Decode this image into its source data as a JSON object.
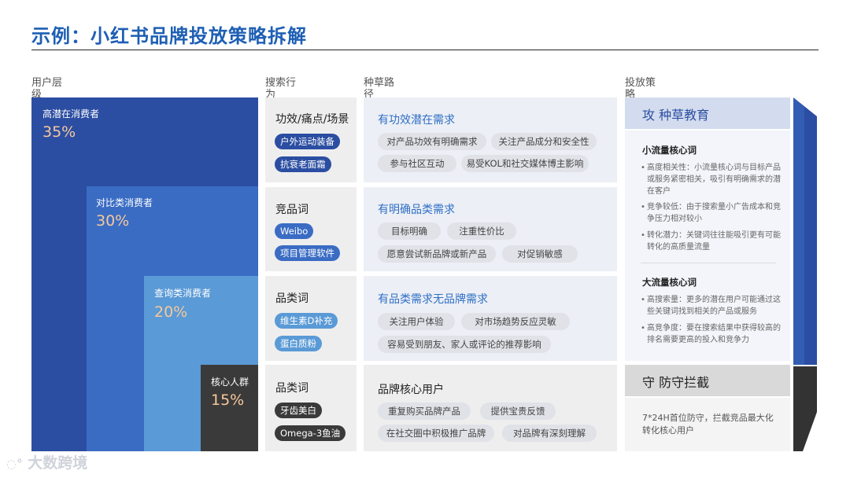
{
  "title": "示例：小红书品牌投放策略拆解",
  "headers": {
    "layer": "用户层级",
    "search": "搜索行为",
    "path": "种草路径",
    "strategy": "投放策略"
  },
  "pyramid": [
    {
      "label": "高潜在消费者",
      "pct": "35%",
      "color": "#2b4ea2"
    },
    {
      "label": "对比类消费者",
      "pct": "30%",
      "color": "#3a6cc4"
    },
    {
      "label": "查询类消费者",
      "pct": "20%",
      "color": "#5a9ad6"
    },
    {
      "label": "核心人群",
      "pct": "15%",
      "color": "#3a3a3a"
    }
  ],
  "search": [
    {
      "title": "功效/痛点/场景",
      "tags": [
        "户外运动装备",
        "抗衰老面霜"
      ]
    },
    {
      "title": "竞品词",
      "tags": [
        "Weibo",
        "项目管理软件"
      ]
    },
    {
      "title": "品类词",
      "tags": [
        "维生素D补充",
        "蛋白质粉"
      ]
    },
    {
      "title": "品类词",
      "tags": [
        "牙齿美白",
        "Omega-3鱼油"
      ]
    }
  ],
  "paths": [
    {
      "title": "有功效潜在需求",
      "pills": [
        "对产品功效有明确需求",
        "关注产品成分和安全性",
        "参与社区互动",
        "易受KOL和社交媒体博主影响"
      ]
    },
    {
      "title": "有明确品类需求",
      "pills": [
        "目标明确",
        "注重性价比",
        "愿意尝试新品牌或新产品",
        "对促销敏感"
      ]
    },
    {
      "title": "有品类需求无品牌需求",
      "pills": [
        "关注用户体验",
        "对市场趋势反应灵敏",
        "容易受到朋友、家人或评论的推荐影响"
      ]
    },
    {
      "title": "品牌核心用户",
      "pills": [
        "重复购买品牌产品",
        "提供宝贵反馈",
        "在社交圈中积极推广品牌",
        "对品牌有深刻理解"
      ]
    }
  ],
  "attack": {
    "head": "攻  种草教育",
    "small_title": "小流量核心词",
    "small_bullets": [
      "高度相关性：小流量核心词与目标产品或服务紧密相关，吸引有明确需求的潜在客户",
      "竞争较低：由于搜索量小广告成本和竞争压力相对较小",
      "转化潜力：关键词往往能吸引更有可能转化的高质量流量"
    ],
    "large_title": "大流量核心词",
    "large_bullets": [
      "高搜索量：更多的潜在用户可能通过这些关键词找到相关的产品或服务",
      "高竞争度：要在搜索结果中获得较高的排名需要更高的投入和竞争力"
    ]
  },
  "defend": {
    "head": "守  防守拦截",
    "text": "7*24H首位防守，拦截竞品最大化转化核心用户"
  },
  "watermark": "大数跨境",
  "colors": {
    "brand_blue": "#1e5fb4",
    "path_blue": "#2f6fc6",
    "arrow_blue": "#2b4ea2",
    "arrow_dark": "#333333"
  }
}
